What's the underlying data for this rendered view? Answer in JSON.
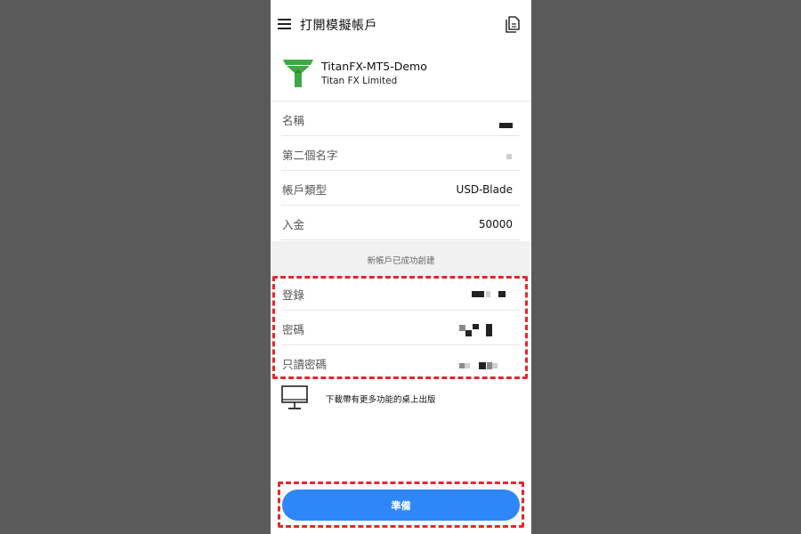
{
  "appbar": {
    "title": "打開模擬帳戶",
    "menu_icon": "hamburger-menu-icon",
    "docs_icon": "documents-icon"
  },
  "server": {
    "name": "TitanFX-MT5-Demo",
    "company": "Titan FX Limited"
  },
  "form": {
    "fields": [
      {
        "label": "名稱",
        "value": ""
      },
      {
        "label": "第二個名字",
        "value": ""
      },
      {
        "label": "帳戶類型",
        "value": "USD-Blade"
      },
      {
        "label": "入金",
        "value": "50000"
      }
    ]
  },
  "status": {
    "success_message": "新帳戶已成功創建"
  },
  "credentials": {
    "login_label": "登錄",
    "password_label": "密碼",
    "readonly_password_label": "只讀密碼"
  },
  "desktop": {
    "text": "下載帶有更多功能的桌上出版"
  },
  "footer": {
    "ready_label": "準備"
  },
  "colors": {
    "primary_button": "#2f86f7",
    "highlight_dash": "#e8262c",
    "logo_green": "#3da845"
  }
}
